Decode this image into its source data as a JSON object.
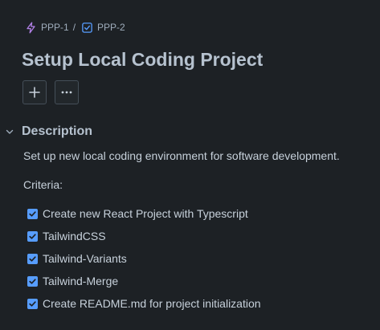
{
  "breadcrumb": {
    "parent": {
      "label": "PPP-1",
      "icon": "epic-lightning-icon",
      "color": "#b180e6"
    },
    "separator": "/",
    "current": {
      "label": "PPP-2",
      "icon": "task-checkbox-icon",
      "color": "#579dff"
    }
  },
  "page_title": "Setup Local Coding Project",
  "actions": [
    {
      "icon": "plus-icon"
    },
    {
      "icon": "more-horizontal-icon"
    }
  ],
  "description": {
    "title": "Description",
    "expanded": true,
    "body": "Set up new local coding environment for software development.",
    "criteria_label": "Criteria:",
    "checklist": [
      {
        "label": "Create new React Project with Typescript",
        "checked": true
      },
      {
        "label": "TailwindCSS",
        "checked": true
      },
      {
        "label": "Tailwind-Variants",
        "checked": true
      },
      {
        "label": "Tailwind-Merge",
        "checked": true
      },
      {
        "label": "Create README.md for project initialization",
        "checked": true
      }
    ]
  },
  "colors": {
    "background": "#1d2125",
    "text": "#c7d1db",
    "heading": "#b6c2cf",
    "accent": "#579dff"
  }
}
